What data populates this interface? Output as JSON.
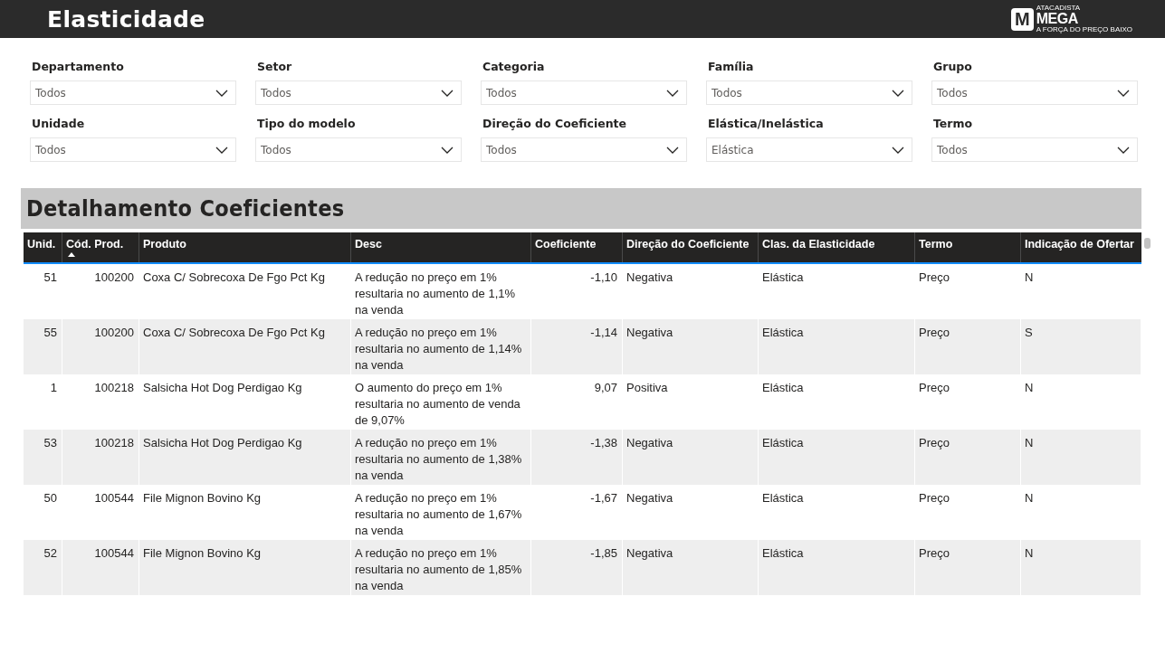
{
  "header": {
    "title": "Elasticidade",
    "logo": {
      "mark": "M",
      "tagline_top": "ATACADISTA",
      "name": "MEGA",
      "slogan": "A FORÇA DO PREÇO BAIXO"
    }
  },
  "filters": [
    {
      "label": "Departamento",
      "value": "Todos"
    },
    {
      "label": "Setor",
      "value": "Todos"
    },
    {
      "label": "Categoria",
      "value": "Todos"
    },
    {
      "label": "Família",
      "value": "Todos"
    },
    {
      "label": "Grupo",
      "value": "Todos"
    },
    {
      "label": "Unidade",
      "value": "Todos"
    },
    {
      "label": "Tipo do modelo",
      "value": "Todos"
    },
    {
      "label": "Direção do Coeficiente",
      "value": "Todos"
    },
    {
      "label": "Elástica/Inelástica",
      "value": "Elástica"
    },
    {
      "label": "Termo",
      "value": "Todos"
    }
  ],
  "table": {
    "title": "Detalhamento Coeficientes",
    "columns": [
      {
        "label": "Unid.",
        "sorted": false
      },
      {
        "label": "Cód. Prod.",
        "sorted": true
      },
      {
        "label": "Produto",
        "sorted": false
      },
      {
        "label": "Desc",
        "sorted": false
      },
      {
        "label": "Coeficiente",
        "sorted": false
      },
      {
        "label": "Direção do Coeficiente",
        "sorted": false
      },
      {
        "label": "Clas. da Elasticidade",
        "sorted": false
      },
      {
        "label": "Termo",
        "sorted": false
      },
      {
        "label": "Indicação de Ofertar",
        "sorted": false
      }
    ],
    "rows": [
      [
        "51",
        "100200",
        "Coxa C/ Sobrecoxa De Fgo Pct Kg",
        "A redução no preço em 1% resultaria no aumento de 1,1% na venda",
        "-1,10",
        "Negativa",
        "Elástica",
        "Preço",
        "N"
      ],
      [
        "55",
        "100200",
        "Coxa C/ Sobrecoxa De Fgo Pct Kg",
        "A redução no preço em 1% resultaria no aumento de 1,14% na venda",
        "-1,14",
        "Negativa",
        "Elástica",
        "Preço",
        "S"
      ],
      [
        "1",
        "100218",
        "Salsicha Hot Dog Perdigao Kg",
        "O aumento do preço em 1% resultaria no aumento de venda de 9,07%",
        "9,07",
        "Positiva",
        "Elástica",
        "Preço",
        "N"
      ],
      [
        "53",
        "100218",
        "Salsicha Hot Dog Perdigao Kg",
        "A redução no preço em 1% resultaria no aumento de 1,38% na venda",
        "-1,38",
        "Negativa",
        "Elástica",
        "Preço",
        "N"
      ],
      [
        "50",
        "100544",
        "File Mignon Bovino Kg",
        "A redução no preço em 1% resultaria no aumento de 1,67% na venda",
        "-1,67",
        "Negativa",
        "Elástica",
        "Preço",
        "N"
      ],
      [
        "52",
        "100544",
        "File Mignon Bovino Kg",
        "A redução no preço em 1% resultaria no aumento de 1,85% na venda",
        "-1,85",
        "Negativa",
        "Elástica",
        "Preço",
        "N"
      ]
    ]
  }
}
